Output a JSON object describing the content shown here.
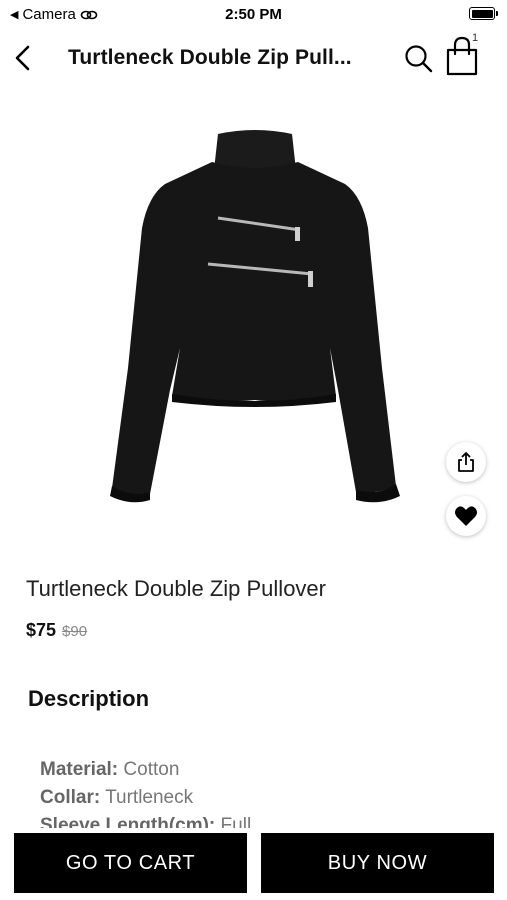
{
  "status_bar": {
    "back_app": "Camera",
    "time": "2:50 PM"
  },
  "header": {
    "title": "Turtleneck Double Zip Pull...",
    "cart_count": "1"
  },
  "product": {
    "name": "Turtleneck Double Zip Pullover",
    "price": "$75",
    "original_price": "$90"
  },
  "description": {
    "heading": "Description",
    "specs": [
      {
        "key": "Material:",
        "value": "Cotton"
      },
      {
        "key": "Collar:",
        "value": "Turtleneck"
      },
      {
        "key": "Sleeve Length(cm):",
        "value": "Full"
      }
    ]
  },
  "actions": {
    "go_to_cart": "GO TO CART",
    "buy_now": "BUY NOW"
  }
}
